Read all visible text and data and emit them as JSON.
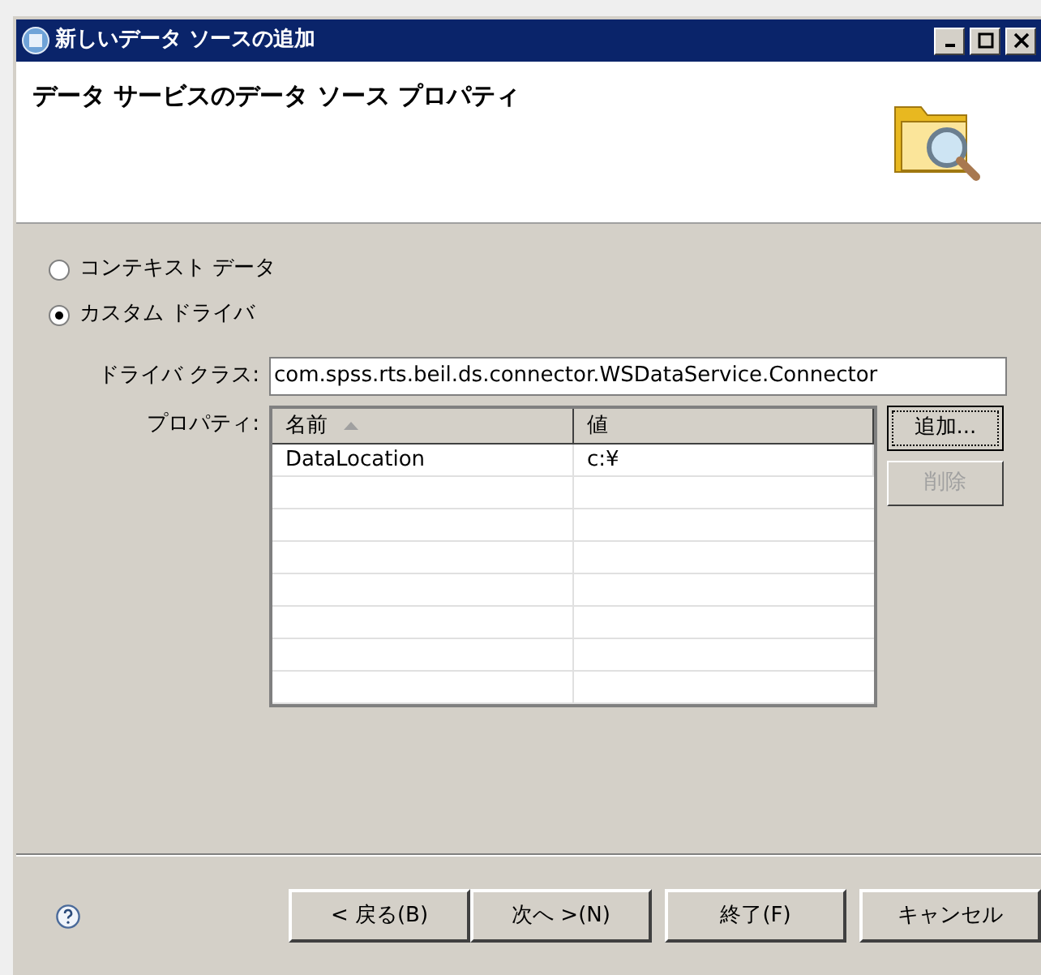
{
  "window": {
    "title": "新しいデータ ソースの追加"
  },
  "header": {
    "title": "データ サービスのデータ ソース プロパティ"
  },
  "source_options": [
    {
      "label": "コンテキスト データ",
      "selected": false
    },
    {
      "label": "カスタム ドライバ",
      "selected": true
    }
  ],
  "driver_class": {
    "label": "ドライバ クラス:",
    "value": "com.spss.rts.beil.ds.connector.WSDataService.Connector"
  },
  "properties": {
    "label": "プロパティ:",
    "columns": [
      {
        "label": "名前",
        "sorted": true
      },
      {
        "label": "値",
        "sorted": false
      }
    ],
    "rows": [
      [
        "DataLocation",
        "c:¥"
      ]
    ],
    "buttons": [
      {
        "label": "追加...",
        "disabled": false,
        "focused": true
      },
      {
        "label": "削除",
        "disabled": true,
        "focused": false
      }
    ]
  },
  "footer_buttons": [
    "< 戻る(B)",
    "次へ >(N)",
    "終了(F)",
    "キャンセル"
  ]
}
